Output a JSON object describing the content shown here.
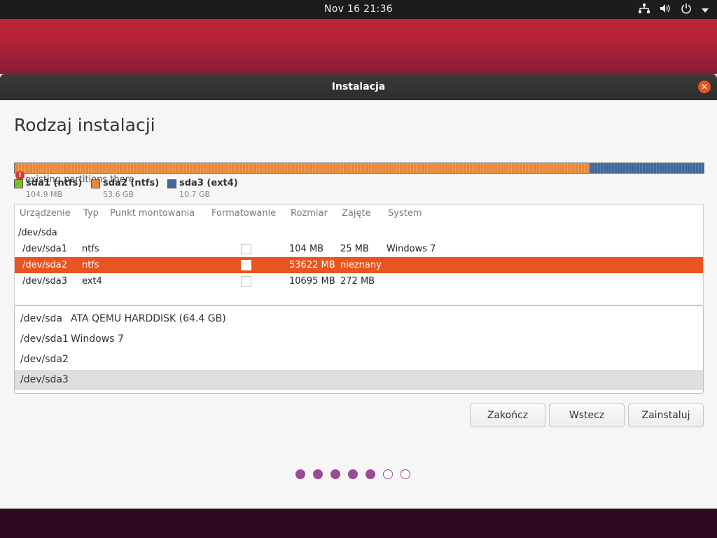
{
  "topbar": {
    "clock": "Nov 16  21:36",
    "tray_icons": [
      "network-icon",
      "volume-icon",
      "power-icon",
      "caret-down-icon"
    ]
  },
  "window": {
    "title": "Instalacja",
    "heading": "Rodzaj instalacji"
  },
  "overlay_message": "existing partitions there",
  "legend": [
    {
      "name": "sda1 (ntfs)",
      "size": "104.9 MB",
      "color": "#7bbf2a"
    },
    {
      "name": "sda2 (ntfs)",
      "size": "53.6 GB",
      "color": "#e9873a"
    },
    {
      "name": "sda3 (ext4)",
      "size": "10.7 GB",
      "color": "#44679a"
    }
  ],
  "partition_table": {
    "headers": [
      "Urządzenie",
      "Typ",
      "Punkt montowania",
      "Formatowanie",
      "Rozmiar",
      "Zajęte",
      "System"
    ],
    "disk": "/dev/sda",
    "rows": [
      {
        "device": "/dev/sda1",
        "type": "ntfs",
        "mount": "",
        "format": false,
        "size": "104 MB",
        "used": "25 MB",
        "system": "Windows 7",
        "selected": false
      },
      {
        "device": "/dev/sda2",
        "type": "ntfs",
        "mount": "",
        "format": false,
        "size": "53622 MB",
        "used": "nieznany",
        "system": "",
        "selected": true
      },
      {
        "device": "/dev/sda3",
        "type": "ext4",
        "mount": "",
        "format": false,
        "size": "10695 MB",
        "used": "272 MB",
        "system": "",
        "selected": false
      }
    ]
  },
  "device_list": [
    {
      "device": "/dev/sda",
      "desc": "ATA QEMU HARDDISK (64.4 GB)",
      "highlighted": false
    },
    {
      "device": "/dev/sda1",
      "desc": "Windows 7",
      "highlighted": false
    },
    {
      "device": "/dev/sda2",
      "desc": "",
      "highlighted": false
    },
    {
      "device": "/dev/sda3",
      "desc": "",
      "highlighted": true
    }
  ],
  "buttons": {
    "quit": "Zakończ",
    "back": "Wstecz",
    "install": "Zainstaluj"
  },
  "progress": {
    "total_steps": 7,
    "completed_steps": 5,
    "color": "#9b4b93"
  },
  "colors": {
    "accent": "#e95420"
  }
}
